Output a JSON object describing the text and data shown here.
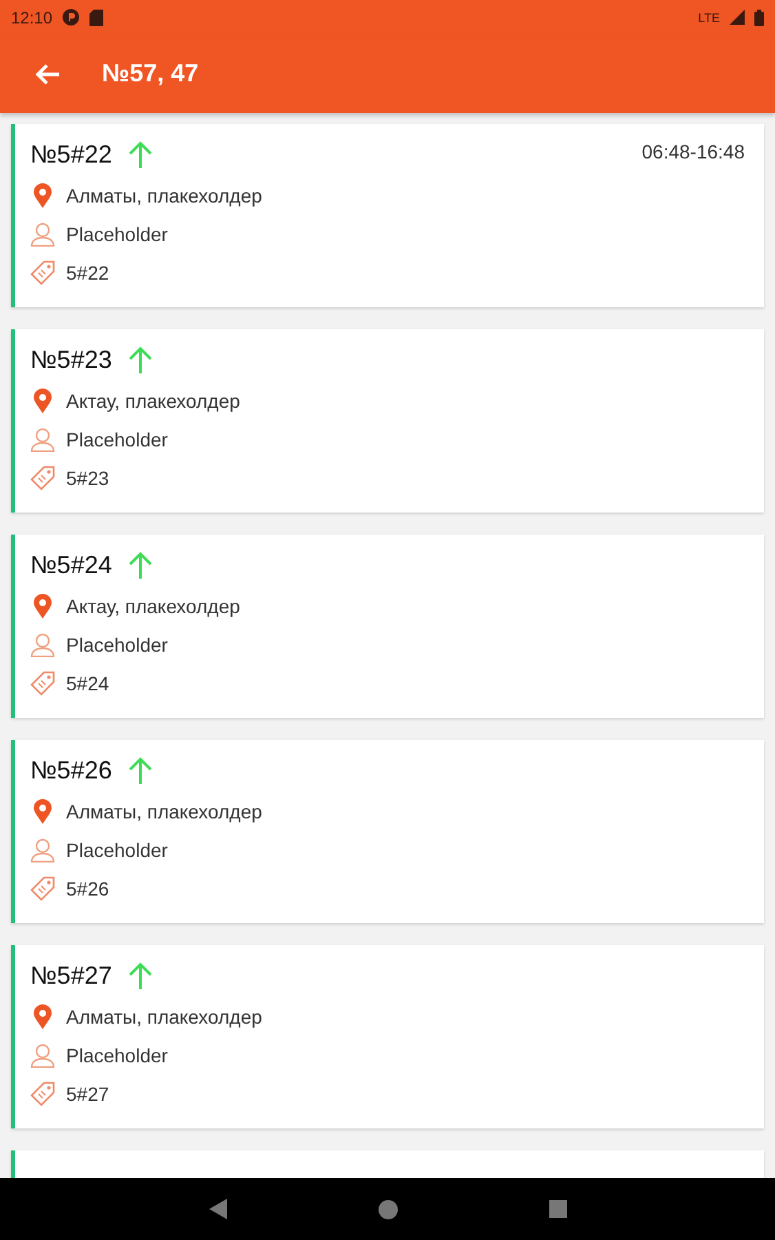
{
  "status_bar": {
    "time": "12:10",
    "network": "LTE"
  },
  "toolbar": {
    "title": "№57, 47"
  },
  "orders": [
    {
      "title": "№5#22",
      "time": "06:48-16:48",
      "city": "Алматы, плакехолдер",
      "person": "Placeholder",
      "tag": "5#22"
    },
    {
      "title": "№5#23",
      "city": "Актау, плакехолдер",
      "person": "Placeholder",
      "tag": "5#23"
    },
    {
      "title": "№5#24",
      "city": "Актау, плакехолдер",
      "person": "Placeholder",
      "tag": "5#24"
    },
    {
      "title": "№5#26",
      "city": "Алматы, плакехолдер",
      "person": "Placeholder",
      "tag": "5#26"
    },
    {
      "title": "№5#27",
      "city": "Алматы, плакехолдер",
      "person": "Placeholder",
      "tag": "5#27"
    },
    {
      "kind": "partial"
    }
  ]
}
